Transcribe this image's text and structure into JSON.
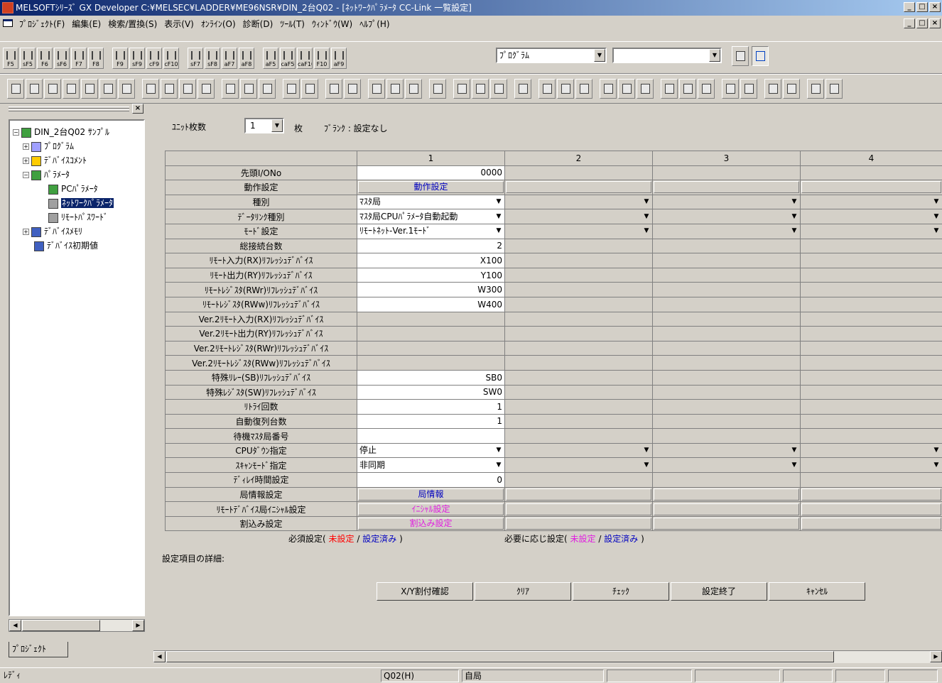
{
  "window": {
    "title": "MELSOFTｼﾘｰｽﾞ GX Developer C:¥MELSEC¥LADDER¥ME96NSR¥DIN_2台Q02 - [ﾈｯﾄﾜｰｸﾊﾟﾗﾒｰﾀ CC-Link 一覧設定]",
    "min": "_",
    "max": "□",
    "close": "×"
  },
  "menu": [
    "ﾌﾟﾛｼﾞｪｸﾄ(F)",
    "編集(E)",
    "検索/置換(S)",
    "表示(V)",
    "ｵﾝﾗｲﾝ(O)",
    "診断(D)",
    "ﾂｰﾙ(T)",
    "ｳｨﾝﾄﾞｳ(W)",
    "ﾍﾙﾌﾟ(H)"
  ],
  "toolbar": {
    "keys": [
      "F5",
      "sF5",
      "F6",
      "sF6",
      "F7",
      "F8",
      "F9",
      "sF9",
      "cF9",
      "cF10",
      "sF7",
      "sF8",
      "aF7",
      "aF8",
      "aF5",
      "caF5",
      "caF10",
      "F10",
      "aF9"
    ],
    "mode_select": "ﾌﾟﾛｸﾞﾗﾑ",
    "second_select": ""
  },
  "tree": {
    "root": "DIN_2台Q02 ｻﾝﾌﾟﾙ",
    "items": [
      {
        "label": "ﾌﾟﾛｸﾞﾗﾑ",
        "color": "#a0a0ff"
      },
      {
        "label": "ﾃﾞﾊﾞｲｽｺﾒﾝﾄ",
        "color": "#ffcc00"
      },
      {
        "label": "ﾊﾟﾗﾒｰﾀ",
        "color": "#40a040"
      },
      {
        "label": "PCﾊﾟﾗﾒｰﾀ",
        "color": "#40a040"
      },
      {
        "label": "ﾈｯﾄﾜｰｸﾊﾟﾗﾒｰﾀ",
        "color": "#a0a0a0"
      },
      {
        "label": "ﾘﾓｰﾄﾊﾟｽﾜｰﾄﾞ",
        "color": "#a0a0a0"
      },
      {
        "label": "ﾃﾞﾊﾞｲｽﾒﾓﾘ",
        "color": "#4060c0"
      },
      {
        "label": "ﾃﾞﾊﾞｲｽ初期値",
        "color": "#4060c0"
      }
    ],
    "tab": "ﾌﾟﾛｼﾞｪｸﾄ"
  },
  "unit": {
    "label": "ﾕﾆｯﾄ枚数",
    "value": "1",
    "suffix": "枚",
    "blank_note": "ﾌﾞﾗﾝｸ : 設定なし"
  },
  "grid": {
    "columns": [
      "1",
      "2",
      "3",
      "4"
    ],
    "rows": [
      {
        "label": "先頭I/ONo",
        "value": "0000",
        "kind": "text"
      },
      {
        "label": "動作設定",
        "value": "動作設定",
        "kind": "button",
        "color": "blue"
      },
      {
        "label": "種別",
        "value": "ﾏｽﾀ局",
        "kind": "combo"
      },
      {
        "label": "ﾃﾞｰﾀﾘﾝｸ種別",
        "value": "ﾏｽﾀ局CPUﾊﾟﾗﾒｰﾀ自動起動",
        "kind": "combo"
      },
      {
        "label": "ﾓｰﾄﾞ設定",
        "value": "ﾘﾓｰﾄﾈｯﾄ-Ver.1ﾓｰﾄﾞ",
        "kind": "combo"
      },
      {
        "label": "総接続台数",
        "value": "2",
        "kind": "text"
      },
      {
        "label": "ﾘﾓｰﾄ入力(RX)ﾘﾌﾚｯｼｭﾃﾞﾊﾞｲｽ",
        "value": "X100",
        "kind": "text"
      },
      {
        "label": "ﾘﾓｰﾄ出力(RY)ﾘﾌﾚｯｼｭﾃﾞﾊﾞｲｽ",
        "value": "Y100",
        "kind": "text"
      },
      {
        "label": "ﾘﾓｰﾄﾚｼﾞｽﾀ(RWr)ﾘﾌﾚｯｼｭﾃﾞﾊﾞｲｽ",
        "value": "W300",
        "kind": "text"
      },
      {
        "label": "ﾘﾓｰﾄﾚｼﾞｽﾀ(RWw)ﾘﾌﾚｯｼｭﾃﾞﾊﾞｲｽ",
        "value": "W400",
        "kind": "text"
      },
      {
        "label": "Ver.2ﾘﾓｰﾄ入力(RX)ﾘﾌﾚｯｼｭﾃﾞﾊﾞｲｽ",
        "value": "",
        "kind": "gray"
      },
      {
        "label": "Ver.2ﾘﾓｰﾄ出力(RY)ﾘﾌﾚｯｼｭﾃﾞﾊﾞｲｽ",
        "value": "",
        "kind": "gray"
      },
      {
        "label": "Ver.2ﾘﾓｰﾄﾚｼﾞｽﾀ(RWr)ﾘﾌﾚｯｼｭﾃﾞﾊﾞｲｽ",
        "value": "",
        "kind": "gray"
      },
      {
        "label": "Ver.2ﾘﾓｰﾄﾚｼﾞｽﾀ(RWw)ﾘﾌﾚｯｼｭﾃﾞﾊﾞｲｽ",
        "value": "",
        "kind": "gray"
      },
      {
        "label": "特殊ﾘﾚｰ(SB)ﾘﾌﾚｯｼｭﾃﾞﾊﾞｲｽ",
        "value": "SB0",
        "kind": "text"
      },
      {
        "label": "特殊ﾚｼﾞｽﾀ(SW)ﾘﾌﾚｯｼｭﾃﾞﾊﾞｲｽ",
        "value": "SW0",
        "kind": "text"
      },
      {
        "label": "ﾘﾄﾗｲ回数",
        "value": "1",
        "kind": "text"
      },
      {
        "label": "自動復列台数",
        "value": "1",
        "kind": "text"
      },
      {
        "label": "待機ﾏｽﾀ局番号",
        "value": "",
        "kind": "text"
      },
      {
        "label": "CPUﾀﾞｳﾝ指定",
        "value": "停止",
        "kind": "combo"
      },
      {
        "label": "ｽｷｬﾝﾓｰﾄﾞ指定",
        "value": "非同期",
        "kind": "combo"
      },
      {
        "label": "ﾃﾞｨﾚｲ時間設定",
        "value": "0",
        "kind": "text"
      },
      {
        "label": "局情報設定",
        "value": "局情報",
        "kind": "button",
        "color": "blue"
      },
      {
        "label": "ﾘﾓｰﾄﾃﾞﾊﾞｲｽ局ｲﾆｼｬﾙ設定",
        "value": "ｲﾆｼｬﾙ設定",
        "kind": "button",
        "color": "magenta"
      },
      {
        "label": "割込み設定",
        "value": "割込み設定",
        "kind": "button",
        "color": "magenta"
      }
    ]
  },
  "legend": {
    "required": "必須設定(",
    "unset": "未設定",
    "sep": "/",
    "set": "設定済み",
    "close": ")",
    "optional": "必要に応じ設定("
  },
  "detail_label": "設定項目の詳細:",
  "buttons": [
    "X/Y割付確認",
    "ｸﾘｱ",
    "ﾁｪｯｸ",
    "設定終了",
    "ｷｬﾝｾﾙ"
  ],
  "status": {
    "ready": "ﾚﾃﾞｨ",
    "cpu": "Q02(H)",
    "station": "自局"
  },
  "colors": {
    "title_start": "#0a246a",
    "title_end": "#a6caf0",
    "unset": "#ff0000",
    "set": "#0000c0",
    "optional_unset": "#e020e0"
  }
}
